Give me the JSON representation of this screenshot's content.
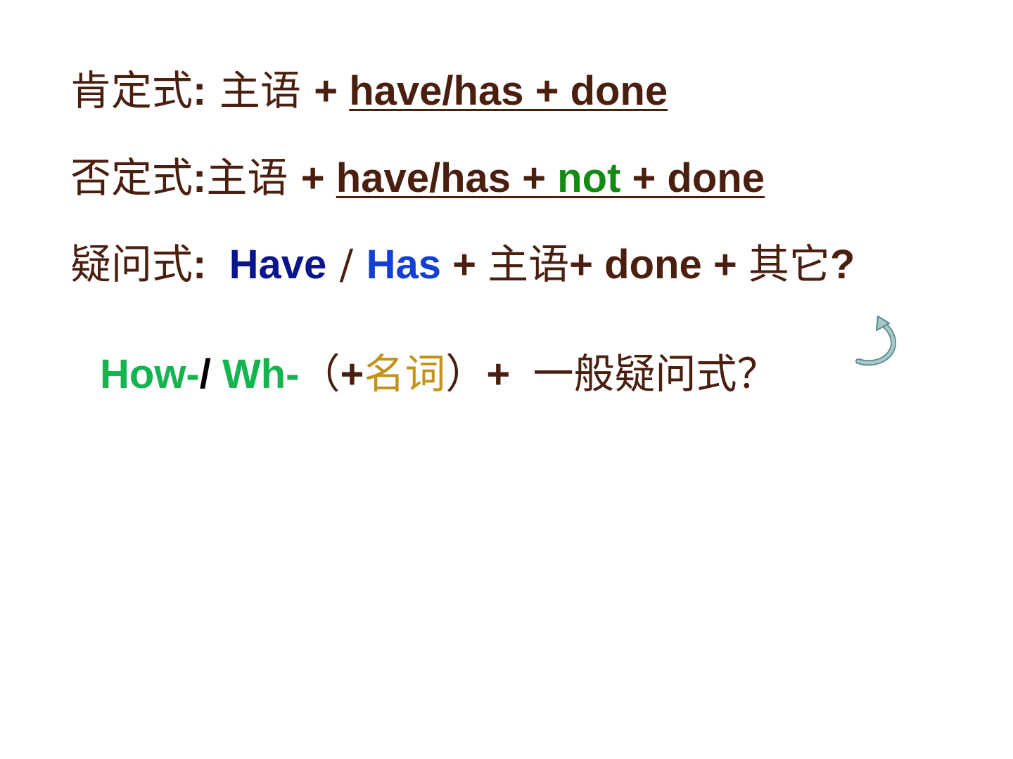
{
  "line1": {
    "label": "肯定式",
    "colon": ":",
    "subject": " 主语 ",
    "plus": "+ ",
    "formula": "have/has + done"
  },
  "line2": {
    "label": "否定式",
    "colon": ":",
    "subject": "主语 ",
    "plus": "+ ",
    "formula_a": "have/has + ",
    "formula_not": "not ",
    "formula_b": "+ done"
  },
  "line3": {
    "label": "疑问式",
    "colon": ":  ",
    "have": "Have",
    "slash": " / ",
    "has": "Has",
    "plus1": " + ",
    "subject": "主语",
    "rest": "+ done + ",
    "other": "其它",
    "question_mark": "?"
  },
  "line4": {
    "how": "How-",
    "slash": "/ ",
    "wh": "Wh-",
    "paren_open": "（",
    "plus1": "+",
    "noun": "名词",
    "paren_close": "）",
    "plus2": "+  ",
    "general_question": "一般疑问式？"
  },
  "colors": {
    "text_brown": "#4a1f0f",
    "have_navy": "#0a148c",
    "has_blue": "#1440d2",
    "not_green": "#138a13",
    "wh_green": "#14b44e",
    "noun_gold": "#c39216",
    "arrow": "#6f9ea0"
  },
  "icons": {
    "arrow": "curved-arrow-icon"
  }
}
